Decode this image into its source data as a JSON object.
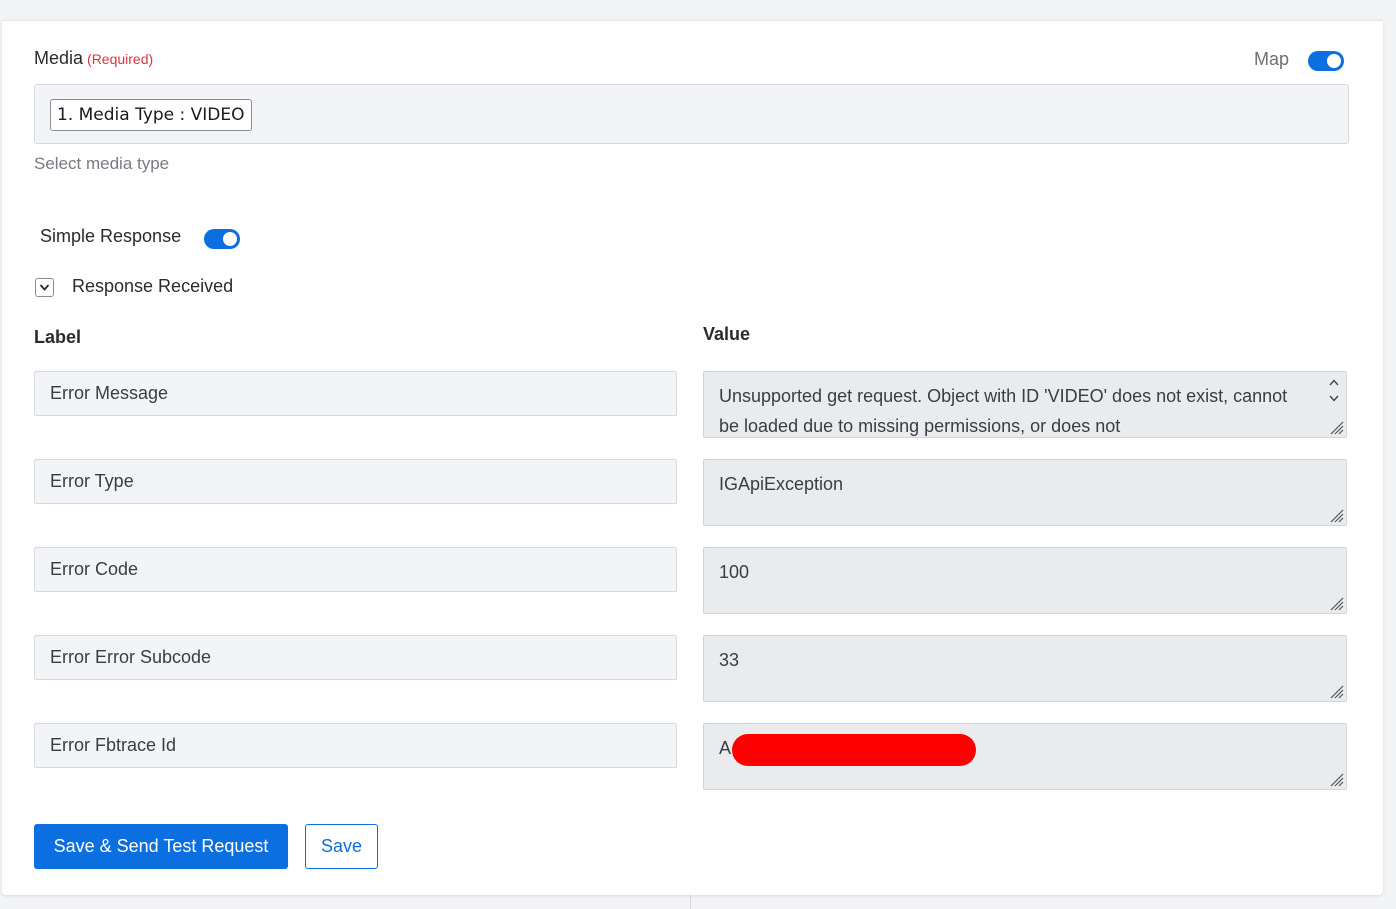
{
  "media": {
    "label": "Media",
    "required_tag": "(Required)",
    "map_label": "Map",
    "map_toggle_on": true,
    "token": "1. Media Type : VIDEO",
    "helper": "Select media type"
  },
  "simple_response": {
    "label": "Simple Response",
    "toggle_on": true
  },
  "response_received": {
    "label": "Response Received",
    "expanded": true
  },
  "table": {
    "label_header": "Label",
    "value_header": "Value",
    "rows": [
      {
        "label": "Error Message",
        "value": "Unsupported get request. Object with ID 'VIDEO' does not exist, cannot be loaded due to missing permissions, or does not"
      },
      {
        "label": "Error Type",
        "value": "IGApiException"
      },
      {
        "label": "Error Code",
        "value": "100"
      },
      {
        "label": "Error Error Subcode",
        "value": "33"
      },
      {
        "label": "Error Fbtrace Id",
        "value": "A"
      }
    ]
  },
  "buttons": {
    "save_send": "Save & Send Test Request",
    "save": "Save"
  },
  "colors": {
    "accent": "#0b6fe0",
    "required": "#d9363e",
    "redaction": "#ff0000"
  }
}
